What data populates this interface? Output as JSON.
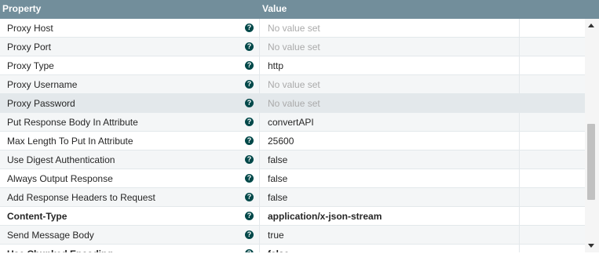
{
  "header": {
    "property_label": "Property",
    "value_label": "Value"
  },
  "properties": [
    {
      "name": "Proxy Host",
      "value": "No value set",
      "empty": true
    },
    {
      "name": "Proxy Port",
      "value": "No value set",
      "empty": true
    },
    {
      "name": "Proxy Type",
      "value": "http",
      "empty": false
    },
    {
      "name": "Proxy Username",
      "value": "No value set",
      "empty": true
    },
    {
      "name": "Proxy Password",
      "value": "No value set",
      "empty": true,
      "selected": true
    },
    {
      "name": "Put Response Body In Attribute",
      "value": "convertAPI",
      "empty": false
    },
    {
      "name": "Max Length To Put In Attribute",
      "value": "25600",
      "empty": false
    },
    {
      "name": "Use Digest Authentication",
      "value": "false",
      "empty": false
    },
    {
      "name": "Always Output Response",
      "value": "false",
      "empty": false
    },
    {
      "name": "Add Response Headers to Request",
      "value": "false",
      "empty": false
    },
    {
      "name": "Content-Type",
      "value": "application/x-json-stream",
      "empty": false,
      "required": true
    },
    {
      "name": "Send Message Body",
      "value": "true",
      "empty": false
    },
    {
      "name": "Use Chunked Encoding",
      "value": "false",
      "empty": false,
      "required": true
    }
  ],
  "icons": {
    "help": "question-circle-icon",
    "scroll_up": "arrow-up-icon",
    "scroll_down": "arrow-down-icon"
  },
  "colors": {
    "header_bg": "#728e9b",
    "help_icon": "#004849",
    "selected_row": "#e3e8eb",
    "empty_value": "#aaaaaa"
  }
}
